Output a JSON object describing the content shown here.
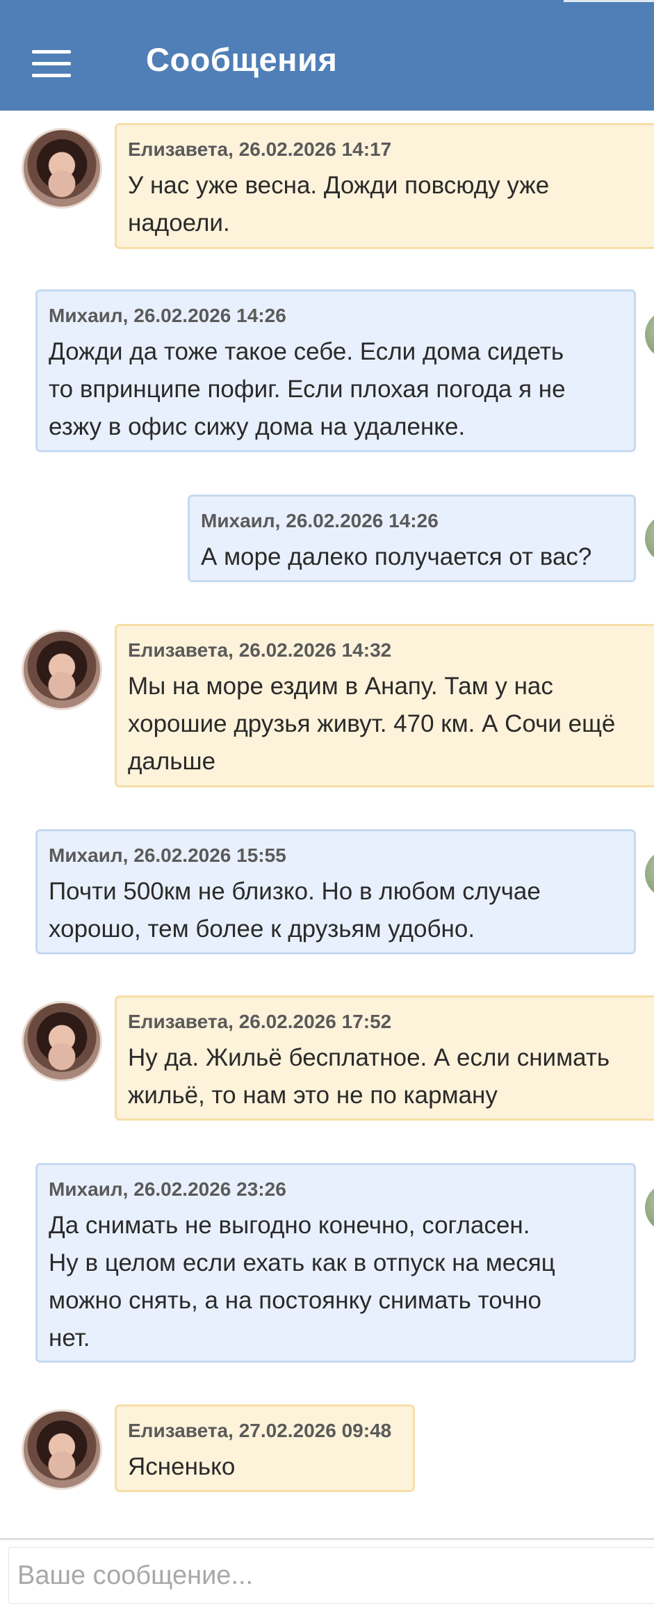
{
  "header": {
    "title": "Сообщения",
    "menu_icon": "hamburger-menu-icon"
  },
  "colors": {
    "header": "#4f7fb6",
    "incoming_bubble": "#fdf2da",
    "outgoing_bubble": "#e8f0fd"
  },
  "messages": [
    {
      "author": "Елизавета",
      "timestamp": "Елизавета, 26.02.2026 14:17",
      "text": "У нас уже весна. Дожди повсюду уже\nнадоели."
    },
    {
      "author": "Михаил",
      "timestamp": "Михаил, 26.02.2026 14:26",
      "text": "Дожди да тоже такое себе. Если дома сидеть\nто впринципе пофиг. Если плохая погода я не\nезжу в офис сижу дома на удаленке."
    },
    {
      "author": "Михаил",
      "timestamp": "Михаил, 26.02.2026 14:26",
      "text": "А море далеко получается от вас?"
    },
    {
      "author": "Елизавета",
      "timestamp": "Елизавета, 26.02.2026 14:32",
      "text": "Мы на море ездим в Анапу. Там у нас\nхорошие друзья живут. 470 км. А Сочи ещё\nдальше"
    },
    {
      "author": "Михаил",
      "timestamp": "Михаил, 26.02.2026 15:55",
      "text": "Почти 500км не близко. Но в любом случае\nхорошо, тем более к друзьям удобно."
    },
    {
      "author": "Елизавета",
      "timestamp": "Елизавета, 26.02.2026 17:52",
      "text": "Ну да. Жильё бесплатное. А если снимать\nжильё, то нам это не по карману"
    },
    {
      "author": "Михаил",
      "timestamp": "Михаил, 26.02.2026 23:26",
      "text": "Да снимать не выгодно конечно, согласен.\nНу в целом если ехать как в отпуск на месяц\nможно снять, а на постоянку снимать точно\nнет."
    },
    {
      "author": "Елизавета",
      "timestamp": "Елизавета, 27.02.2026 09:48",
      "text": "Ясненько"
    }
  ],
  "composer": {
    "placeholder": "Ваше сообщение...",
    "value": ""
  }
}
